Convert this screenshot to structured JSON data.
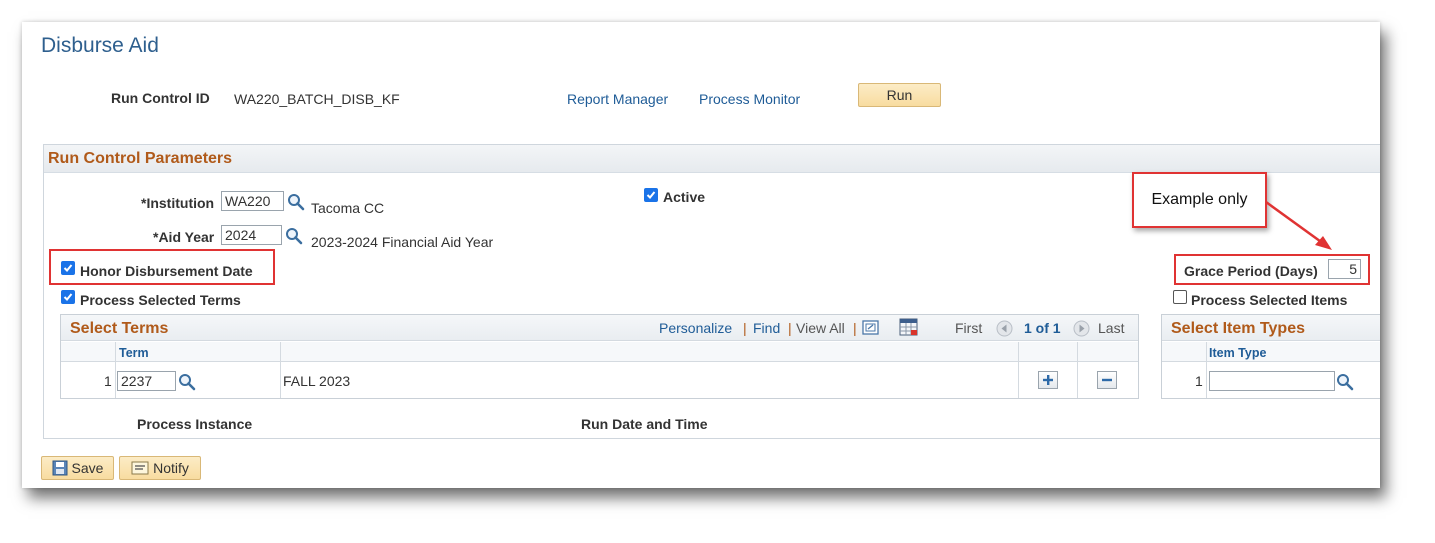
{
  "page": {
    "title": "Disburse Aid"
  },
  "run_control": {
    "label": "Run Control ID",
    "value": "WA220_BATCH_DISB_KF",
    "report_manager": "Report Manager",
    "process_monitor": "Process Monitor",
    "run_label": "Run"
  },
  "params": {
    "section_title": "Run Control Parameters",
    "institution": {
      "label": "*Institution",
      "value": "WA220",
      "description": "Tacoma CC"
    },
    "aid_year": {
      "label": "*Aid Year",
      "value": "2024",
      "description": "2023-2024 Financial Aid Year"
    },
    "active": {
      "label": "Active",
      "checked": true
    },
    "honor_disbursement": {
      "label": "Honor Disbursement Date",
      "checked": true
    },
    "process_selected_terms": {
      "label": "Process Selected Terms",
      "checked": true
    },
    "grace_period": {
      "label": "Grace Period (Days)",
      "value": "5"
    },
    "process_selected_items": {
      "label": "Process Selected Items",
      "checked": false
    }
  },
  "callout": {
    "text": "Example only"
  },
  "terms_grid": {
    "title": "Select Terms",
    "personalize": "Personalize",
    "find": "Find",
    "view_all": "View All",
    "first": "First",
    "page_info": "1 of 1",
    "last": "Last",
    "column_term": "Term",
    "rows": [
      {
        "num": "1",
        "term": "2237",
        "description": "FALL 2023"
      }
    ]
  },
  "item_types_grid": {
    "title": "Select Item Types",
    "column_item_type": "Item Type",
    "rows": [
      {
        "num": "1",
        "value": ""
      }
    ]
  },
  "bottom": {
    "process_instance": "Process Instance",
    "run_date_time": "Run Date and Time"
  },
  "toolbar": {
    "save_label": "Save",
    "notify_label": "Notify"
  },
  "colors": {
    "accent_blue": "#2e5f8e",
    "section_orange": "#b05a1a",
    "callout_red": "#e03333",
    "checkbox_blue": "#1a73e8"
  }
}
